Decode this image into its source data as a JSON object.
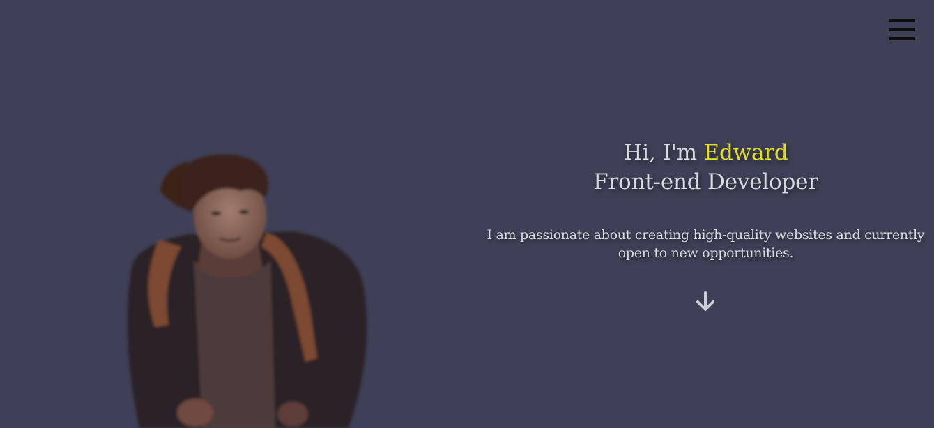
{
  "nav": {
    "menu_icon": "hamburger-menu-icon"
  },
  "hero": {
    "greeting": "Hi, I'm ",
    "name": "Edward",
    "role": "Front-end Developer",
    "description_line1": "I am passionate about creating high-quality websites and currently",
    "description_line2": "open to new opportunities.",
    "scroll_icon": "arrow-down-icon"
  },
  "portrait": {
    "icon": "profile-portrait"
  },
  "colors": {
    "background": "#3f4057",
    "text": "#d9d9e2",
    "accent": "#dedd2e",
    "menu": "#0d0d12"
  }
}
